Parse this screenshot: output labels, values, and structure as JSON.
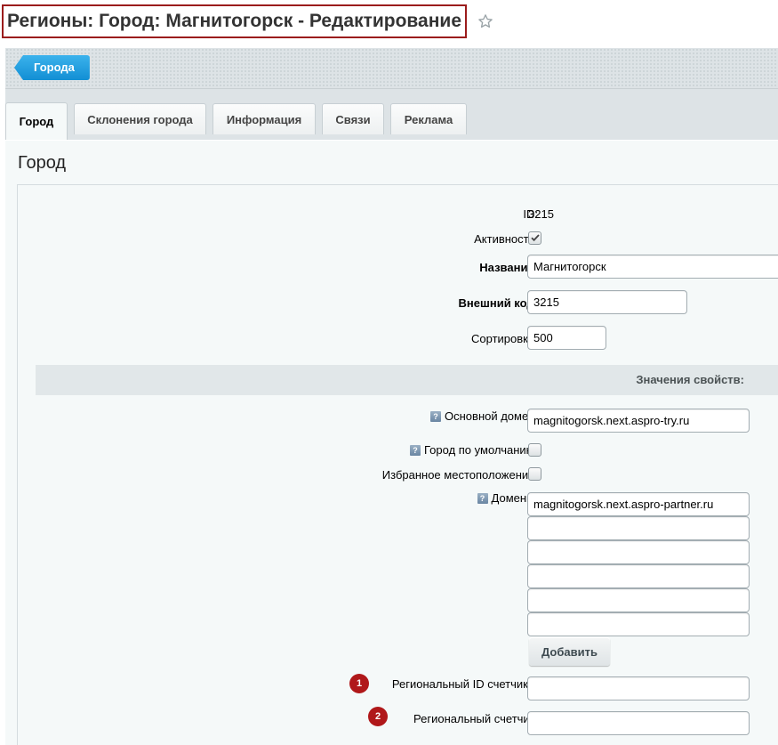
{
  "page": {
    "title": "Регионы: Город: Магнитогорск - Редактирование"
  },
  "toolbar": {
    "back_label": "Города"
  },
  "tabs": [
    {
      "label": "Город"
    },
    {
      "label": "Склонения города"
    },
    {
      "label": "Информация"
    },
    {
      "label": "Связи"
    },
    {
      "label": "Реклама"
    }
  ],
  "section_title": "Город",
  "form": {
    "id_label": "ID:",
    "id_value": "3215",
    "active_label": "Активность:",
    "active_checked": true,
    "name_label": "Название:",
    "name_value": "Магнитогорск",
    "ext_code_label": "Внешний код:",
    "ext_code_value": "3215",
    "sort_label": "Сортировка:",
    "sort_value": "500"
  },
  "props": {
    "header": "Значения свойств:",
    "main_domain_label": "Основной домен:",
    "main_domain_value": "magnitogorsk.next.aspro-try.ru",
    "default_city_label": "Город по умолчанию:",
    "default_city_checked": false,
    "favorite_label": "Избранное местоположение:",
    "favorite_checked": false,
    "domains_label": "Домены:",
    "domains_values": [
      "magnitogorsk.next.aspro-partner.ru",
      "",
      "",
      "",
      "",
      ""
    ],
    "add_label": "Добавить",
    "regional_counter_id_label": "Региональный ID счетчика:",
    "regional_counter_id_value": "",
    "regional_counter_label": "Региональный счетчик:",
    "regional_counter_value": ""
  },
  "badges": {
    "first": "1",
    "second": "2"
  },
  "help_glyph": "?",
  "colors": {
    "accent": "#1a97da",
    "title_border": "#9b1c1c",
    "badge": "#b0181a"
  },
  "icons": {
    "star": "star-icon",
    "help": "help-icon",
    "check": "check-icon"
  }
}
